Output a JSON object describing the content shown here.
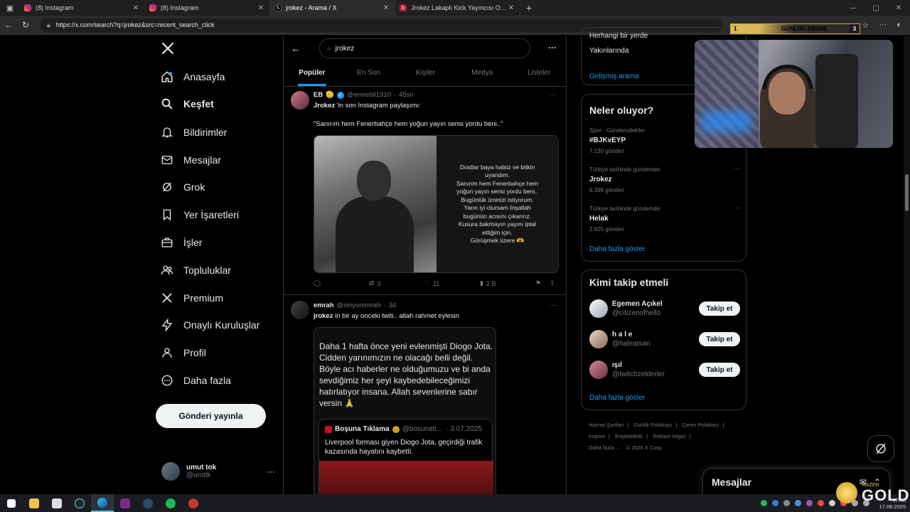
{
  "browser": {
    "tabs": [
      {
        "title": "(8) Instagram",
        "favicon": "instagram"
      },
      {
        "title": "(8) Instagram",
        "favicon": "instagram"
      },
      {
        "title": "jrokez - Arama / X",
        "favicon": "x"
      },
      {
        "title": "Jrokez Lakaplı Kick Yayıncısı Oğu...",
        "favicon": "kick"
      }
    ],
    "url": "https://x.com/search?q=jrokez&src=recent_search_click"
  },
  "overlay": {
    "sub_left": "1",
    "sub_label": "GÜNLÜK ABONE",
    "sub_right": "3",
    "gold_text": "GOLD",
    "razer": "RAZER"
  },
  "nav": {
    "items": [
      {
        "label": "Anasayfa",
        "icon": "home-icon"
      },
      {
        "label": "Keşfet",
        "icon": "search-icon"
      },
      {
        "label": "Bildirimler",
        "icon": "bell-icon"
      },
      {
        "label": "Mesajlar",
        "icon": "mail-icon"
      },
      {
        "label": "Grok",
        "icon": "grok-icon"
      },
      {
        "label": "Yer İşaretleri",
        "icon": "bookmark-icon"
      },
      {
        "label": "İşler",
        "icon": "briefcase-icon"
      },
      {
        "label": "Topluluklar",
        "icon": "people-icon"
      },
      {
        "label": "Premium",
        "icon": "x-icon"
      },
      {
        "label": "Onaylı Kuruluşlar",
        "icon": "lightning-icon"
      },
      {
        "label": "Profil",
        "icon": "person-icon"
      },
      {
        "label": "Daha fazla",
        "icon": "more-circle-icon"
      }
    ],
    "post_button": "Gönderi yayınla",
    "account": {
      "name": "umut tok",
      "handle": "@umttk"
    }
  },
  "search": {
    "query": "jrokez",
    "tabs": [
      "Popüler",
      "En Son",
      "Kişiler",
      "Medya",
      "Listeler"
    ],
    "active_tab": "Popüler"
  },
  "tweets": [
    {
      "name": "EB",
      "handle": "@emrebll1910",
      "time": "45sn",
      "line1_bold": "Jrokez",
      "line1_rest": " 'in son Instagram paylaşımı:",
      "line2": "\"Sanırım hem Fenerbahçe hem yoğun yayın serisi yordu beni..\"",
      "note": "Dostlar baya halsiz ve bitkin\nuyandım.\nSanırım hem Fenerbahçe hem\nyoğun yayın serisi yordu beni..\nBugünlük izninizi istiyorum.\nYarın iyi olursam İnşallah\nbugünün acısını çıkarırız.\nKusura bakmayın yayını iptal\nettiğim için.\nGörüşmek üzere 🫶",
      "retweets": "3",
      "likes": "11",
      "views": "2 B"
    },
    {
      "name": "emrah",
      "handle": "@sinyoremrah",
      "time": "3d",
      "text_bold": "jrokez",
      "text_rest": " in bir ay onceki twiti.. allah rahmet eylesin",
      "embed_text": "Daha 1 hafta önce yeni evlenmişti Diogo Jota. Cidden yarınımızın ne olacağı belli değil. Böyle acı haberler ne olduğumuzu ve bi anda sevdiğimiz her şeyi kaybedebileceğimizi hatırlatıyor insana. Allah sevenlerine sabır versin 🙏",
      "quote_name": "Boşuna Tıklama",
      "quote_handle": "@bosunati...",
      "quote_date": "3.07.2025",
      "quote_text": "Liverpool forması giyen Diogo Jota, geçirdiği trafik kazasında hayatını kaybetti."
    }
  ],
  "right": {
    "top_partial_1": "Herhangi bir yerde",
    "top_partial_2": "Yakınlarında",
    "advanced": "Gelişmiş arama",
    "trends_title": "Neler oluyor?",
    "trends": [
      {
        "context": "Spor · Gündemdekiler",
        "title": "#BJKvEYP",
        "count": "7.130 gönderi"
      },
      {
        "context": "Türkiye tarihinde gündemde",
        "title": "Jrokez",
        "count": "6.396 gönderi"
      },
      {
        "context": "Türkiye tarihinde gündemde",
        "title": "Helak",
        "count": "2.625 gönderi"
      }
    ],
    "show_more": "Daha fazla göster",
    "who_title": "Kimi takip etmeli",
    "who": [
      {
        "name": "Egemen Açıkel",
        "handle": "@citizenofhello",
        "button": "Takip et"
      },
      {
        "name": "h a l e",
        "handle": "@haleatsan",
        "button": "Takip et"
      },
      {
        "name": "ışıl",
        "handle": "@twitchzelderler",
        "button": "Takip et"
      }
    ],
    "who_more": "Daha fazla göster",
    "footer": [
      "Hizmet Şartları",
      "|",
      "Gizlilik Politikası",
      "|",
      "Çerez Politikası",
      "|",
      "Imprint",
      "|",
      "Erişilebilirlik",
      "|",
      "Reklam bilgisi",
      "|",
      "Daha fazla ···",
      "© 2025 X Corp."
    ]
  },
  "messages": {
    "title": "Mesajlar"
  },
  "taskbar": {
    "time": "17:48",
    "date": "17.08.2025"
  },
  "colors": {
    "accent": "#1d9bf0",
    "bg": "#000000",
    "border": "#2f3336"
  }
}
